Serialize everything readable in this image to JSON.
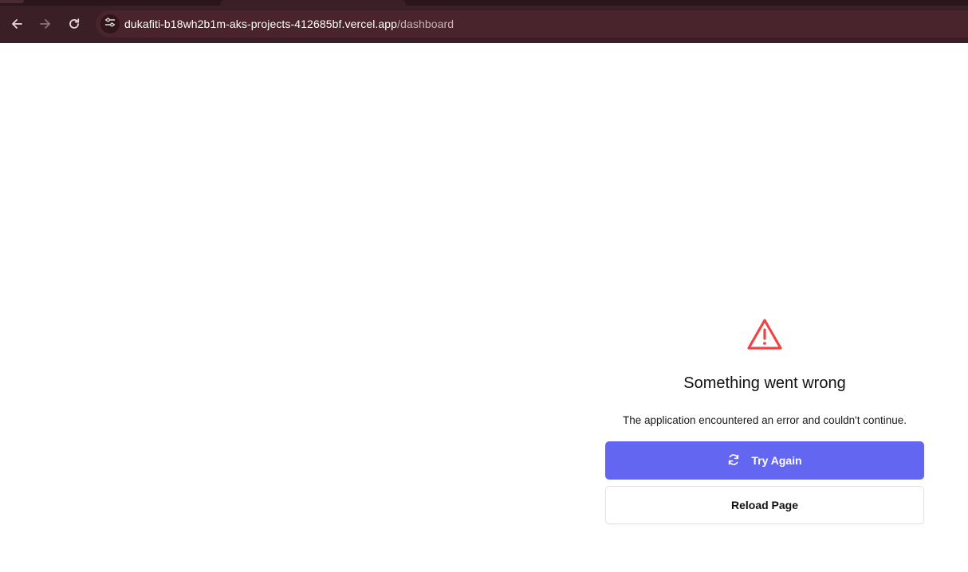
{
  "browser": {
    "url_host": "dukafiti-b18wh2b1m-aks-projects-412685bf.vercel.app",
    "url_path": "/dashboard",
    "icons": {
      "back": "arrow-left-icon",
      "forward": "arrow-right-icon",
      "reload": "reload-icon",
      "site_info": "tune-icon"
    }
  },
  "error": {
    "icon": "warning-triangle-icon",
    "title": "Something went wrong",
    "message": "The application encountered an error and couldn't continue.",
    "try_again_label": "Try Again",
    "try_again_icon": "refresh-icon",
    "reload_label": "Reload Page"
  },
  "colors": {
    "accent": "#6366f1",
    "error_icon": "#ef4444",
    "browser_bar": "#3b1f26"
  }
}
